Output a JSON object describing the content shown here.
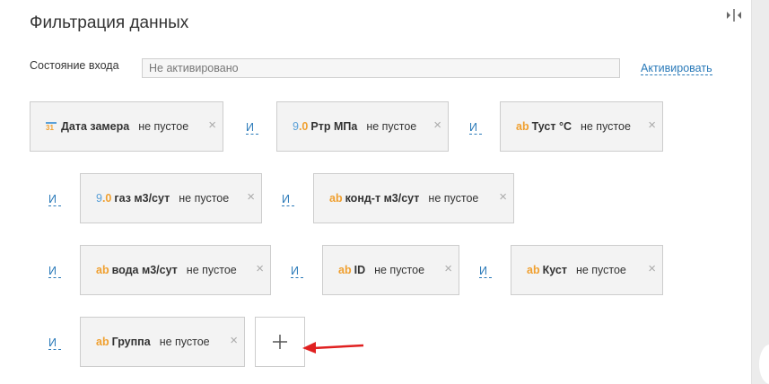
{
  "title": "Фильтрация данных",
  "state": {
    "label": "Состояние входа",
    "value": "Не активировано",
    "action": "Активировать"
  },
  "connector": "И",
  "filters": [
    {
      "icon": "31",
      "icon_type": "date",
      "name": "Дата замера",
      "condition": "не пустое"
    },
    {
      "icon": "9.0",
      "icon_type": "number",
      "name": "Ртр МПа",
      "condition": "не пустое"
    },
    {
      "icon": "ab",
      "icon_type": "text",
      "name": "Туст °С",
      "condition": "не пустое"
    },
    {
      "icon": "9.0",
      "icon_type": "number",
      "name": "газ м3/сут",
      "condition": "не пустое"
    },
    {
      "icon": "ab",
      "icon_type": "text",
      "name": "конд-т м3/сут",
      "condition": "не пустое"
    },
    {
      "icon": "ab",
      "icon_type": "text",
      "name": "вода м3/сут",
      "condition": "не пустое"
    },
    {
      "icon": "ab",
      "icon_type": "text",
      "name": "ID",
      "condition": "не пустое"
    },
    {
      "icon": "ab",
      "icon_type": "text",
      "name": "Куст",
      "condition": "не пустое"
    },
    {
      "icon": "ab",
      "icon_type": "text",
      "name": "Группа",
      "condition": "не пустое"
    }
  ],
  "close_glyph": "×",
  "colors": {
    "link": "#2a7ab9",
    "text_icon": "#f0a030",
    "number_icon": "#5aa0d8",
    "arrow": "#e02020"
  }
}
